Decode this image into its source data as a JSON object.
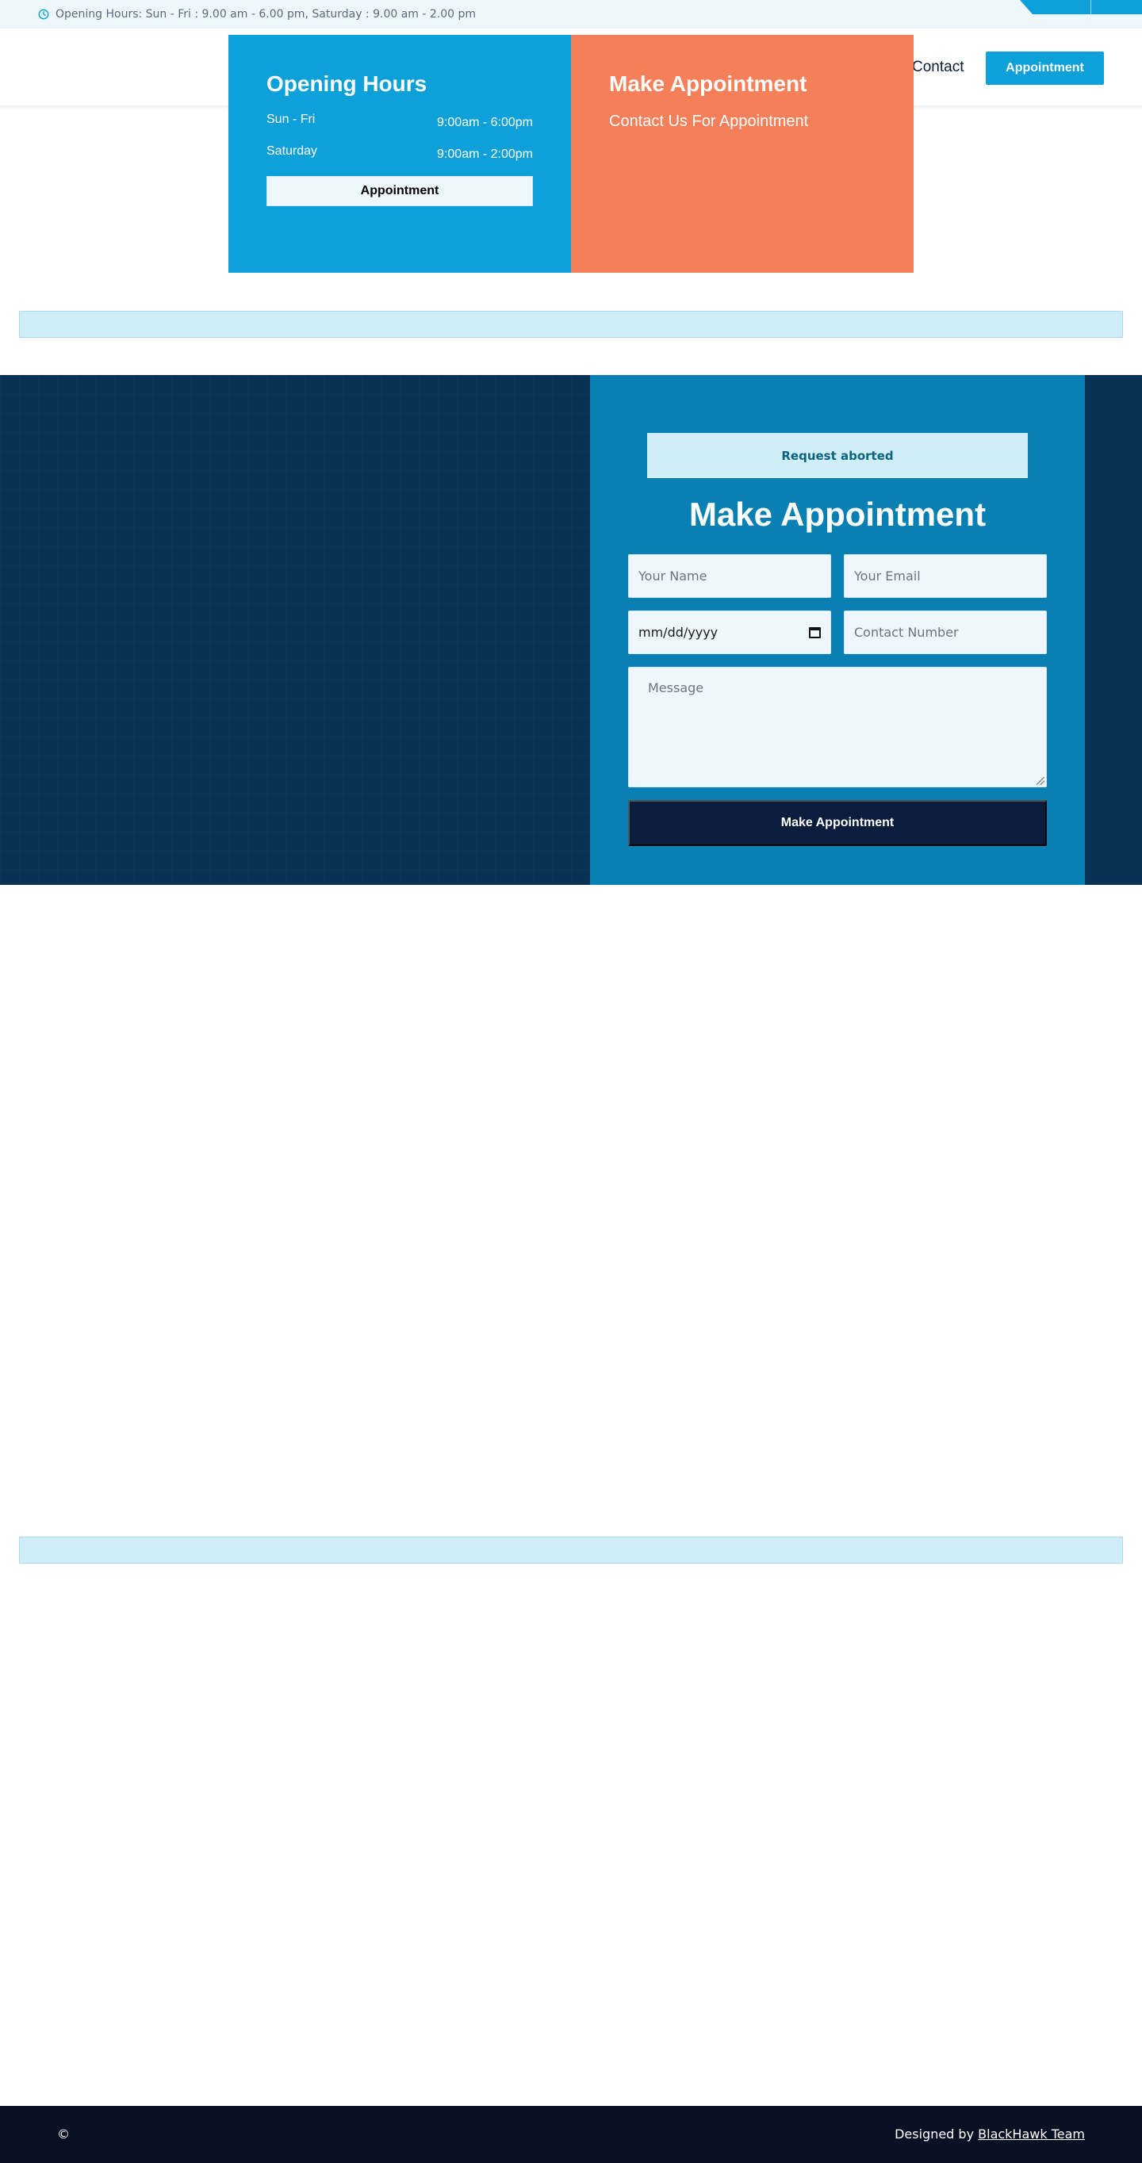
{
  "topbar": {
    "opening_hours": "Opening Hours: Sun - Fri : 9.00 am - 6.00 pm, Saturday : 9.00 am - 2.00 pm"
  },
  "header": {
    "nav_contact": "Contact",
    "appointment_button": "Appointment"
  },
  "hours_card": {
    "title": "Opening Hours",
    "rows": [
      {
        "day": "Sun - Fri",
        "time": "9:00am - 6:00pm"
      },
      {
        "day": "Saturday",
        "time": "9:00am - 2:00pm"
      }
    ],
    "button": "Appointment"
  },
  "make_card": {
    "title": "Make Appointment",
    "subtitle": "Contact Us For Appointment"
  },
  "appointment_form": {
    "alert": "Request aborted",
    "title": "Make Appointment",
    "name_placeholder": "Your Name",
    "email_placeholder": "Your Email",
    "date_placeholder": "mm/dd/yyyy",
    "phone_placeholder": "Contact Number",
    "message_placeholder": "Message",
    "submit": "Make Appointment"
  },
  "footer": {
    "copyright": "©",
    "designed_by": "Designed by",
    "designer_link": "BlackHawk Team"
  },
  "colors": {
    "primary": "#0ea0d8",
    "accent": "#f47f58",
    "dark": "#083154",
    "form_panel": "#0880b3",
    "footer": "#0a1124"
  },
  "icons": {
    "topbar_icon": "clock-icon",
    "date_picker_icon": "calendar-icon"
  }
}
